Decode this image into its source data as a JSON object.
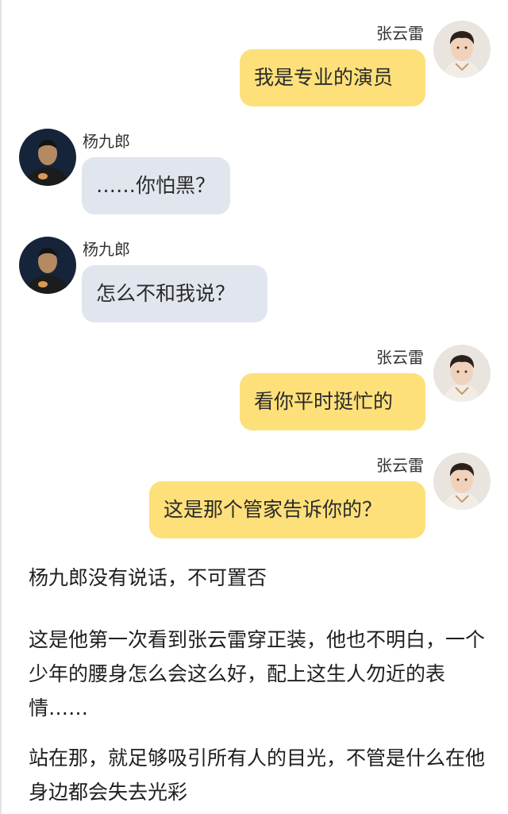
{
  "messages": [
    {
      "side": "right",
      "sender": "张云雷",
      "text": "我是专业的演员"
    },
    {
      "side": "left",
      "sender": "杨九郎",
      "text": "……你怕黑？"
    },
    {
      "side": "left",
      "sender": "杨九郎",
      "text": "怎么不和我说？"
    },
    {
      "side": "right",
      "sender": "张云雷",
      "text": "看你平时挺忙的"
    },
    {
      "side": "right",
      "sender": "张云雷",
      "text": "这是那个管家告诉你的？"
    }
  ],
  "narration": [
    "杨九郎没有说话，不可置否",
    "这是他第一次看到张云雷穿正装，他也不明白，一个少年的腰身怎么会这么好，配上这生人勿近的表情……",
    "站在那，就足够吸引所有人的目光，不管是什么在他身边都会失去光彩"
  ],
  "colors": {
    "right_bubble": "#fde07a",
    "left_bubble": "#e1e6ee"
  }
}
